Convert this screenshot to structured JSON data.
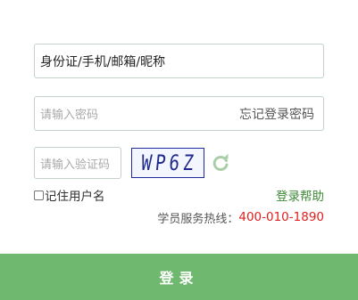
{
  "form": {
    "username_value": "身份证/手机/邮箱/昵称",
    "password_placeholder": "请输入密码",
    "forgot_password": "忘记登录密码",
    "captcha_placeholder": "请输入验证码",
    "captcha_text": "WP6Z",
    "refresh_icon": "refresh-icon",
    "remember_label": "记住用户名",
    "remember_checked": false,
    "help_link": "登录帮助",
    "hotline_label": "学员服务热线：",
    "hotline_number": "400-010-1890",
    "login_button": "登录"
  },
  "colors": {
    "accent_green": "#6fb86f",
    "link_green": "#3f8a3a",
    "hotline_red": "#e02020",
    "captcha_blue": "#1f2a8a"
  }
}
